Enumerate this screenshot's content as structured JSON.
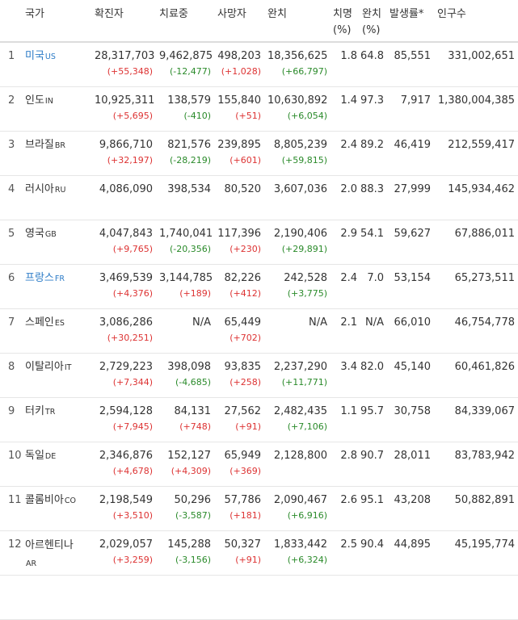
{
  "headers": {
    "country": "국가",
    "confirmed": "확진자",
    "treating": "치료중",
    "deaths": "사망자",
    "recovered": "완치",
    "fatality": "치명 (%)",
    "recovery": "완치 (%)",
    "incidence": "발생률*",
    "population": "인구수"
  },
  "colors": {
    "link": "#2d7cc7",
    "increase": "#dd3333",
    "decrease": "#2a8a2a"
  },
  "rows": [
    {
      "rank": "1",
      "name": "미국",
      "code": "US",
      "link": true,
      "confirmed": "28,317,703",
      "confirmed_delta": "(+55,348)",
      "treating": "9,462,875",
      "treating_delta": "(-12,477)",
      "deaths": "498,203",
      "deaths_delta": "(+1,028)",
      "recovered": "18,356,625",
      "recovered_delta": "(+66,797)",
      "fatality": "1.8",
      "recovery": "64.8",
      "incidence": "85,551",
      "population": "331,002,651"
    },
    {
      "rank": "2",
      "name": "인도",
      "code": "IN",
      "link": false,
      "confirmed": "10,925,311",
      "confirmed_delta": "(+5,695)",
      "treating": "138,579",
      "treating_delta": "(-410)",
      "deaths": "155,840",
      "deaths_delta": "(+51)",
      "recovered": "10,630,892",
      "recovered_delta": "(+6,054)",
      "fatality": "1.4",
      "recovery": "97.3",
      "incidence": "7,917",
      "population": "1,380,004,385"
    },
    {
      "rank": "3",
      "name": "브라질",
      "code": "BR",
      "link": false,
      "confirmed": "9,866,710",
      "confirmed_delta": "(+32,197)",
      "treating": "821,576",
      "treating_delta": "(-28,219)",
      "deaths": "239,895",
      "deaths_delta": "(+601)",
      "recovered": "8,805,239",
      "recovered_delta": "(+59,815)",
      "fatality": "2.4",
      "recovery": "89.2",
      "incidence": "46,419",
      "population": "212,559,417"
    },
    {
      "rank": "4",
      "name": "러시아",
      "code": "RU",
      "link": false,
      "confirmed": "4,086,090",
      "confirmed_delta": "",
      "treating": "398,534",
      "treating_delta": "",
      "deaths": "80,520",
      "deaths_delta": "",
      "recovered": "3,607,036",
      "recovered_delta": "",
      "fatality": "2.0",
      "recovery": "88.3",
      "incidence": "27,999",
      "population": "145,934,462"
    },
    {
      "rank": "5",
      "name": "영국",
      "code": "GB",
      "link": false,
      "confirmed": "4,047,843",
      "confirmed_delta": "(+9,765)",
      "treating": "1,740,041",
      "treating_delta": "(-20,356)",
      "deaths": "117,396",
      "deaths_delta": "(+230)",
      "recovered": "2,190,406",
      "recovered_delta": "(+29,891)",
      "fatality": "2.9",
      "recovery": "54.1",
      "incidence": "59,627",
      "population": "67,886,011"
    },
    {
      "rank": "6",
      "name": "프랑스",
      "code": "FR",
      "link": true,
      "confirmed": "3,469,539",
      "confirmed_delta": "(+4,376)",
      "treating": "3,144,785",
      "treating_delta": "(+189)",
      "deaths": "82,226",
      "deaths_delta": "(+412)",
      "recovered": "242,528",
      "recovered_delta": "(+3,775)",
      "fatality": "2.4",
      "recovery": "7.0",
      "incidence": "53,154",
      "population": "65,273,511"
    },
    {
      "rank": "7",
      "name": "스페인",
      "code": "ES",
      "link": false,
      "confirmed": "3,086,286",
      "confirmed_delta": "(+30,251)",
      "treating": "N/A",
      "treating_delta": "",
      "deaths": "65,449",
      "deaths_delta": "(+702)",
      "recovered": "N/A",
      "recovered_delta": "",
      "fatality": "2.1",
      "recovery": "N/A",
      "incidence": "66,010",
      "population": "46,754,778"
    },
    {
      "rank": "8",
      "name": "이탈리아",
      "code": "IT",
      "link": false,
      "confirmed": "2,729,223",
      "confirmed_delta": "(+7,344)",
      "treating": "398,098",
      "treating_delta": "(-4,685)",
      "deaths": "93,835",
      "deaths_delta": "(+258)",
      "recovered": "2,237,290",
      "recovered_delta": "(+11,771)",
      "fatality": "3.4",
      "recovery": "82.0",
      "incidence": "45,140",
      "population": "60,461,826"
    },
    {
      "rank": "9",
      "name": "터키",
      "code": "TR",
      "link": false,
      "confirmed": "2,594,128",
      "confirmed_delta": "(+7,945)",
      "treating": "84,131",
      "treating_delta": "(+748)",
      "deaths": "27,562",
      "deaths_delta": "(+91)",
      "recovered": "2,482,435",
      "recovered_delta": "(+7,106)",
      "fatality": "1.1",
      "recovery": "95.7",
      "incidence": "30,758",
      "population": "84,339,067"
    },
    {
      "rank": "10",
      "name": "독일",
      "code": "DE",
      "link": false,
      "confirmed": "2,346,876",
      "confirmed_delta": "(+4,678)",
      "treating": "152,127",
      "treating_delta": "(+4,309)",
      "deaths": "65,949",
      "deaths_delta": "(+369)",
      "recovered": "2,128,800",
      "recovered_delta": "",
      "fatality": "2.8",
      "recovery": "90.7",
      "incidence": "28,011",
      "population": "83,783,942"
    },
    {
      "rank": "11",
      "name": "콜롬비아",
      "code": "CO",
      "link": false,
      "confirmed": "2,198,549",
      "confirmed_delta": "(+3,510)",
      "treating": "50,296",
      "treating_delta": "(-3,587)",
      "deaths": "57,786",
      "deaths_delta": "(+181)",
      "recovered": "2,090,467",
      "recovered_delta": "(+6,916)",
      "fatality": "2.6",
      "recovery": "95.1",
      "incidence": "43,208",
      "population": "50,882,891"
    },
    {
      "rank": "12",
      "name": "아르헨티나",
      "code": "AR",
      "link": false,
      "wrap": true,
      "confirmed": "2,029,057",
      "confirmed_delta": "(+3,259)",
      "treating": "145,288",
      "treating_delta": "(-3,156)",
      "deaths": "50,327",
      "deaths_delta": "(+91)",
      "recovered": "1,833,442",
      "recovered_delta": "(+6,324)",
      "fatality": "2.5",
      "recovery": "90.4",
      "incidence": "44,895",
      "population": "45,195,774"
    },
    {
      "rank": "",
      "name": "",
      "code": "",
      "link": false,
      "confirmed": "",
      "confirmed_delta": "",
      "treating": "",
      "treating_delta": "",
      "deaths": "",
      "deaths_delta": "",
      "recovered": "",
      "recovered_delta": "",
      "fatality": "",
      "recovery": "",
      "incidence": "",
      "population": ""
    }
  ]
}
